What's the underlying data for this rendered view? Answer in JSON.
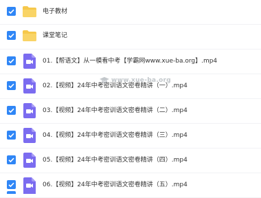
{
  "files": [
    {
      "name": "电子教材",
      "type": "folder",
      "checked": true
    },
    {
      "name": "课堂笔记",
      "type": "folder",
      "checked": true
    },
    {
      "name": "01.【帮语文】从一模看中考【学霸网www.xue-ba.org】.mp4",
      "type": "video",
      "checked": true
    },
    {
      "name": "02.【视频】24年中考密训语文密卷精讲（一）.mp4",
      "type": "video",
      "checked": true
    },
    {
      "name": "03.【视频】24年中考密训语文密卷精讲（二）.mp4",
      "type": "video",
      "checked": true
    },
    {
      "name": "04.【视频】24年中考密训语文密卷精讲（三）.mp4",
      "type": "video",
      "checked": true
    },
    {
      "name": "05.【视频】24年中考密训语文密卷精讲（四）.mp4",
      "type": "video",
      "checked": true
    },
    {
      "name": "06.【视频】24年中考密训语文密卷精讲（五）.mp4",
      "type": "video",
      "checked": true
    }
  ],
  "watermark": {
    "text": "www.xue-ba.org"
  },
  "colors": {
    "checkbox": "#2f86f6",
    "folder": "#f6c84b",
    "video": "#7b6cf0"
  }
}
